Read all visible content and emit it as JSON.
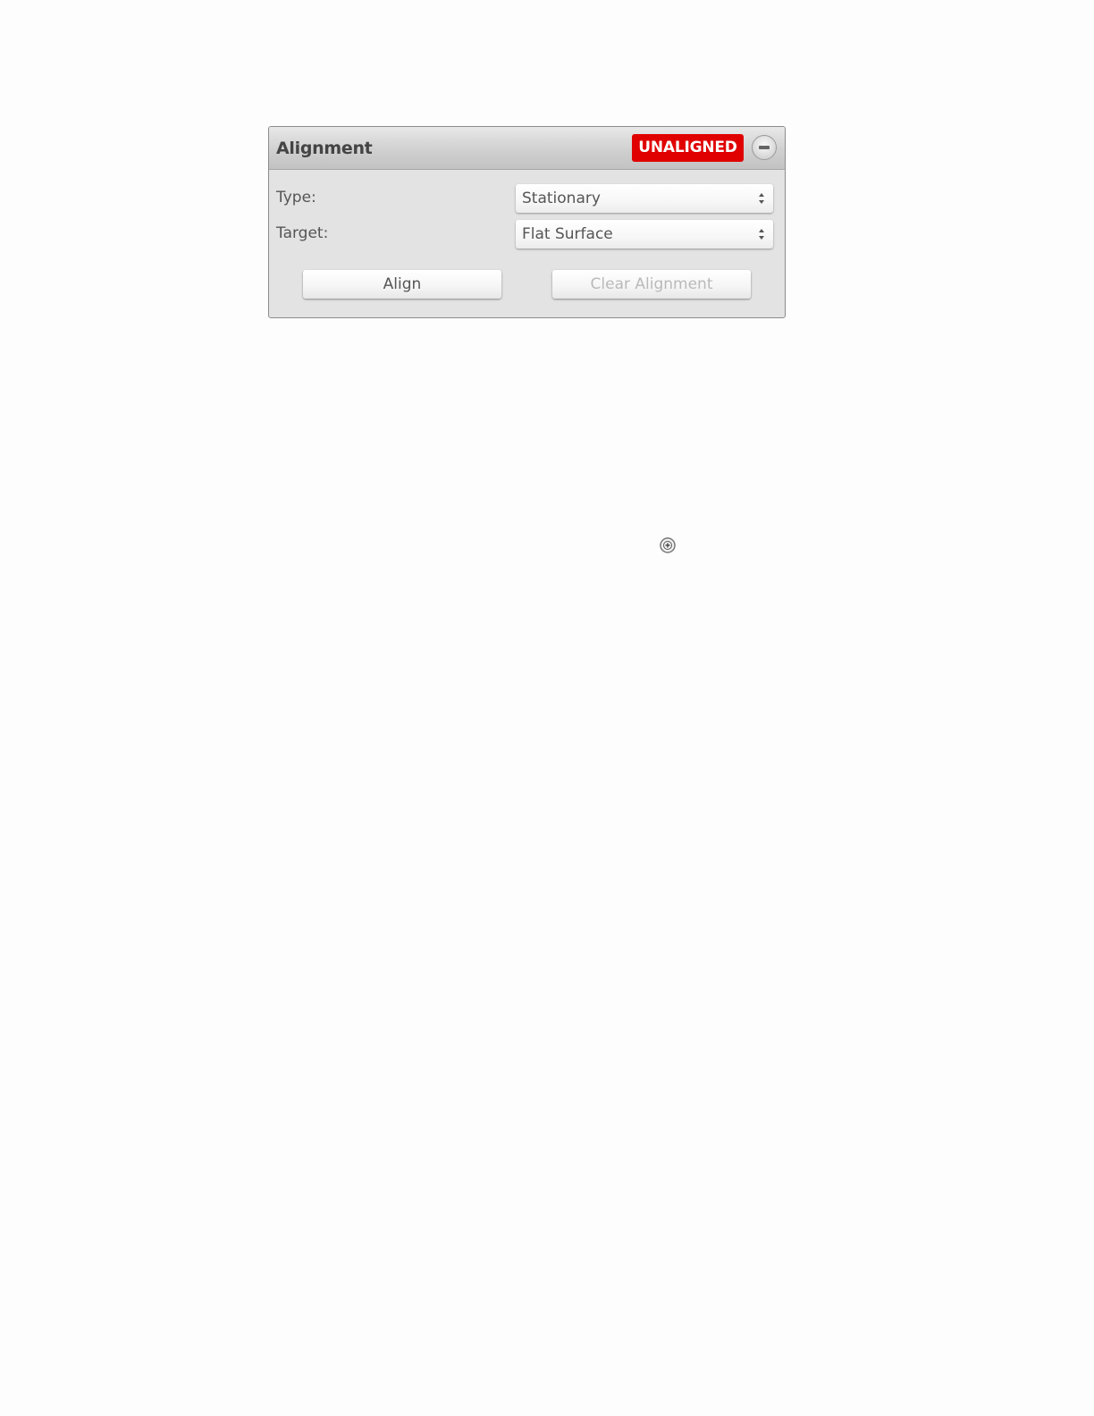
{
  "panel": {
    "title": "Alignment",
    "status_badge": "UNALIGNED",
    "collapse_icon": "minus-circle-icon"
  },
  "fields": {
    "type": {
      "label": "Type:",
      "value": "Stationary"
    },
    "target": {
      "label": "Target:",
      "value": "Flat Surface"
    }
  },
  "buttons": {
    "align_label": "Align",
    "clear_alignment_label": "Clear Alignment",
    "clear_alignment_disabled": true
  },
  "icons": {
    "select_arrows": "up-down-arrows-icon",
    "floating": "add-circle-icon"
  },
  "colors": {
    "status_unaligned": "#e00000",
    "disabled_text": "#b9b9b9"
  }
}
